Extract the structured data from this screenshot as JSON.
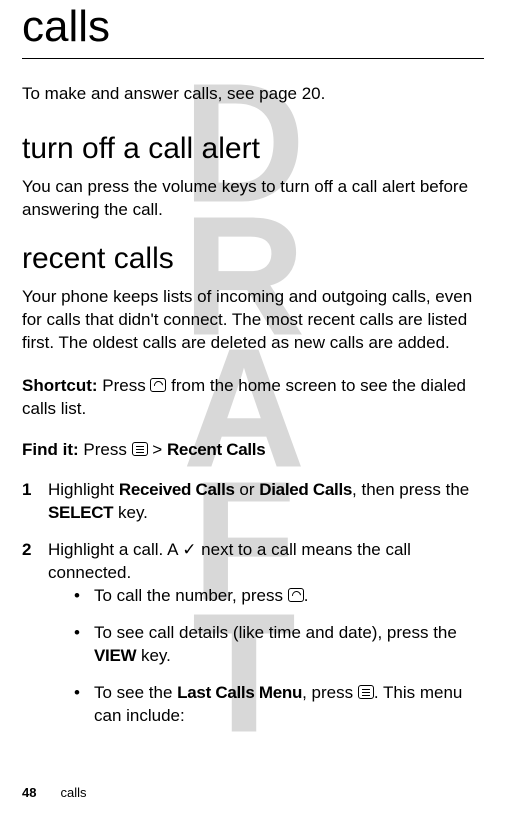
{
  "watermark": "DRAFT",
  "title": "calls",
  "intro": "To make and answer calls, see page 20.",
  "sections": {
    "turnoff": {
      "heading": "turn off a call alert",
      "body": "You can press the volume keys to turn off a call alert before answering the call."
    },
    "recent": {
      "heading": "recent calls",
      "body": "Your phone keeps lists of incoming and outgoing calls, even for calls that didn't connect. The most recent calls are listed first. The oldest calls are deleted as new calls are added.",
      "shortcut_label": "Shortcut:",
      "shortcut_pre": " Press ",
      "shortcut_post": " from the home screen to see the dialed calls list.",
      "findit_label": "Find it:",
      "findit_pre": " Press ",
      "findit_gt": " > ",
      "findit_recent": "Recent Calls",
      "steps": {
        "1": {
          "num": "1",
          "pre": "Highlight ",
          "received": "Received Calls",
          "or": " or ",
          "dialed": "Dialed Calls",
          "mid": ", then press the ",
          "select": "SELECT",
          "post": " key."
        },
        "2": {
          "num": "2",
          "pre": "Highlight a call. A ",
          "check": "✓",
          "post": " next to a call means the call connected."
        }
      },
      "bullets": {
        "b1_pre": "To call the number, press ",
        "b1_post": ".",
        "b2_pre": "To see call details (like time and date), press the ",
        "b2_view": "VIEW",
        "b2_post": " key.",
        "b3_pre": "To see the ",
        "b3_menu": "Last Calls Menu",
        "b3_mid": ", press ",
        "b3_post": ". This menu can include:"
      }
    }
  },
  "footer": {
    "page": "48",
    "section": "calls"
  }
}
